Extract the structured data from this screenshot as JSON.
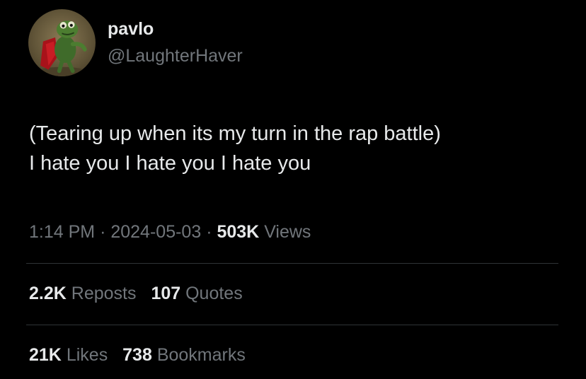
{
  "user": {
    "display_name": "pavlo",
    "handle": "@LaughterHaver",
    "avatar_icon": "frog-figure-avatar"
  },
  "tweet": {
    "lines": [
      "(Tearing up when its my turn in the rap battle)",
      "I hate you I hate you I hate you"
    ]
  },
  "meta": {
    "time": "1:14 PM",
    "separator": "·",
    "date": "2024-05-03",
    "views_count": "503K",
    "views_label": "Views"
  },
  "stats": {
    "reposts_count": "2.2K",
    "reposts_label": "Reposts",
    "quotes_count": "107",
    "quotes_label": "Quotes",
    "likes_count": "21K",
    "likes_label": "Likes",
    "bookmarks_count": "738",
    "bookmarks_label": "Bookmarks"
  },
  "colors": {
    "background": "#000000",
    "primary_text": "#e7e9ea",
    "secondary_text": "#71767b",
    "divider": "#2f3336"
  }
}
